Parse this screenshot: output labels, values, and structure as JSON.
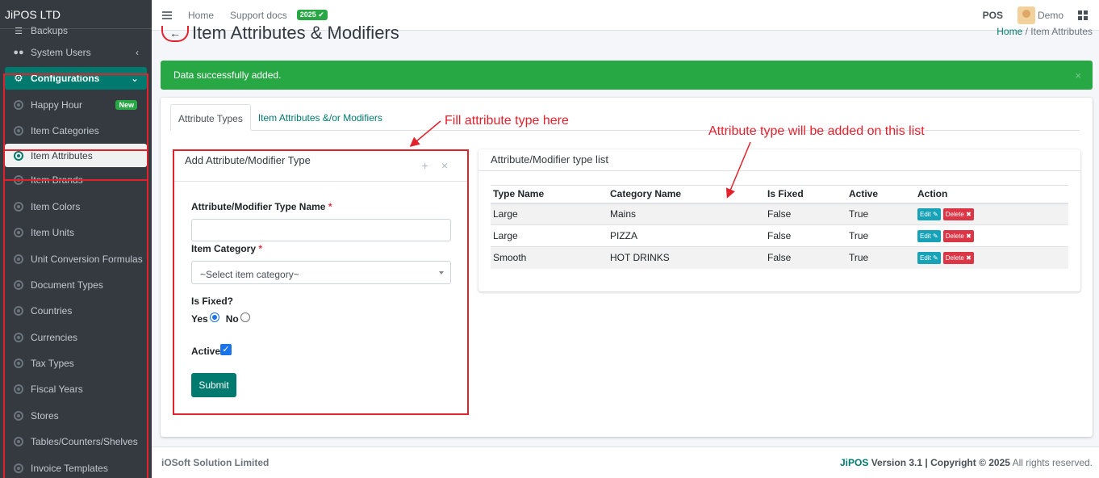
{
  "brand": "JiPOS LTD",
  "topbar": {
    "home": "Home",
    "support": "Support docs",
    "badge": "2025",
    "pos": "POS",
    "user": "Demo"
  },
  "sidebar": {
    "items": [
      {
        "label": "Backups"
      },
      {
        "label": "System Users"
      },
      {
        "label": "Configurations"
      },
      {
        "label": "Happy Hour",
        "badge": "New"
      },
      {
        "label": "Item Categories"
      },
      {
        "label": "Item Attributes"
      },
      {
        "label": "Item Brands"
      },
      {
        "label": "Item Colors"
      },
      {
        "label": "Item Units"
      },
      {
        "label": "Unit Conversion Formulas"
      },
      {
        "label": "Document Types"
      },
      {
        "label": "Countries"
      },
      {
        "label": "Currencies"
      },
      {
        "label": "Tax Types"
      },
      {
        "label": "Fiscal Years"
      },
      {
        "label": "Stores"
      },
      {
        "label": "Tables/Counters/Shelves"
      },
      {
        "label": "Invoice Templates"
      }
    ]
  },
  "page": {
    "title": "Item Attributes & Modifiers",
    "crumb_home": "Home",
    "crumb_sep": "/",
    "crumb_current": "Item Attributes"
  },
  "alert": {
    "message": "Data successfully added.",
    "close": "×"
  },
  "tabs": [
    {
      "label": "Attribute Types"
    },
    {
      "label": "Item Attributes &/or Modifiers"
    }
  ],
  "form": {
    "title": "Add Attribute/Modifier Type",
    "name_label": "Attribute/Modifier Type Name",
    "name_value": "",
    "category_label": "Item Category",
    "category_placeholder": "~Select item category~",
    "is_fixed_label": "Is Fixed?",
    "yes_label": "Yes",
    "no_label": "No",
    "is_fixed_value": "Yes",
    "active_label": "Active",
    "active_checked": true,
    "submit_label": "Submit",
    "required_mark": "*"
  },
  "list": {
    "title": "Attribute/Modifier type list",
    "columns": [
      "Type Name",
      "Category Name",
      "Is Fixed",
      "Active",
      "Action"
    ],
    "rows": [
      {
        "type_name": "Large",
        "category": "Mains",
        "is_fixed": "False",
        "active": "True"
      },
      {
        "type_name": "Large",
        "category": "PIZZA",
        "is_fixed": "False",
        "active": "True"
      },
      {
        "type_name": "Smooth",
        "category": "HOT DRINKS",
        "is_fixed": "False",
        "active": "True"
      }
    ],
    "edit_label": "Edit",
    "delete_label": "Delete"
  },
  "annotations": {
    "fill_note": "Fill attribute type here",
    "list_note": "Attribute type will be added on this list",
    "color": "#e3212d"
  },
  "footer": {
    "company": "iOSoft Solution Limited",
    "product": "JiPOS",
    "version": "Version 3.1 | Copyright © 2025",
    "rights": "All rights reserved."
  },
  "colors": {
    "accent": "#007a6e",
    "success": "#28a745",
    "danger": "#dc3545",
    "info": "#17a2b8"
  }
}
